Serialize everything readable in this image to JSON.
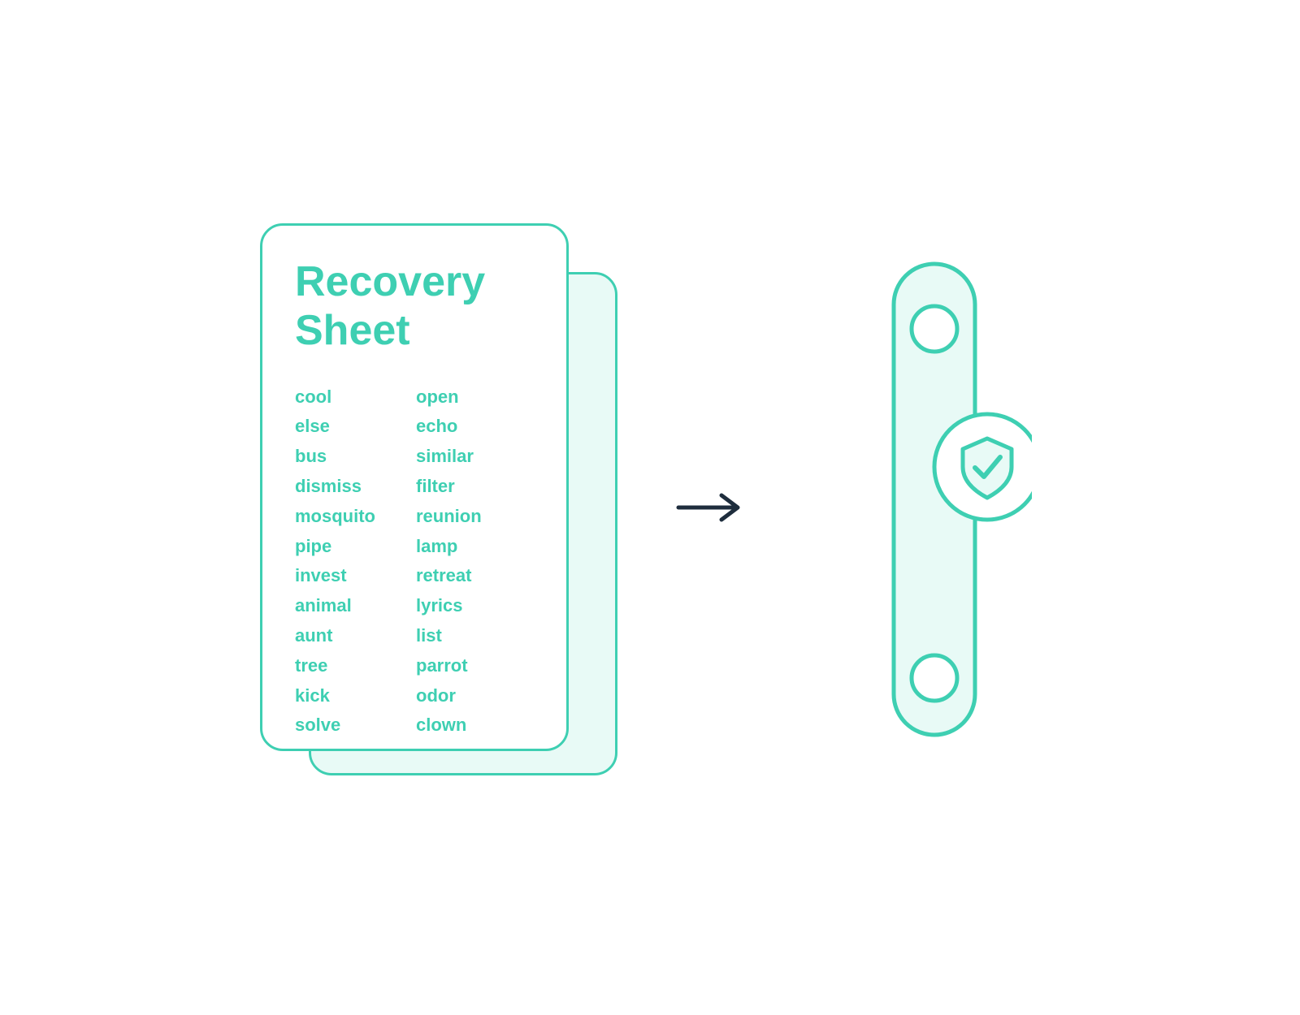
{
  "card": {
    "title_line1": "Recovery",
    "title_line2": "Sheet",
    "words_col1": [
      "cool",
      "else",
      "bus",
      "dismiss",
      "mosquito",
      "pipe",
      "invest",
      "animal",
      "aunt",
      "tree",
      "kick",
      "solve"
    ],
    "words_col2": [
      "open",
      "echo",
      "similar",
      "filter",
      "reunion",
      "lamp",
      "retreat",
      "lyrics",
      "list",
      "parrot",
      "odor",
      "clown"
    ]
  },
  "colors": {
    "teal": "#3ecfb2",
    "teal_light": "#e8faf6",
    "dark": "#1e2d3d",
    "white": "#ffffff"
  }
}
